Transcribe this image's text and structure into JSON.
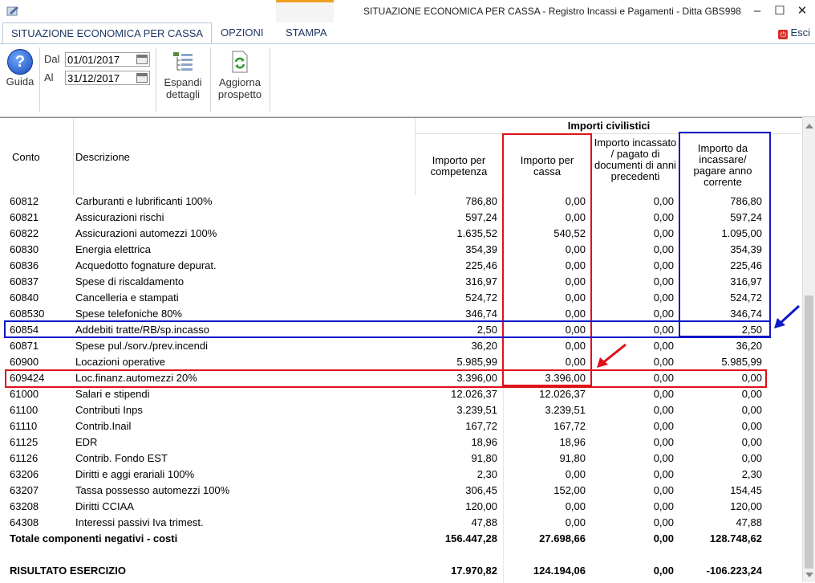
{
  "window": {
    "title": "SITUAZIONE ECONOMICA PER CASSA - Registro Incassi e Pagamenti - Ditta GBS998"
  },
  "tabs": [
    "SITUAZIONE ECONOMICA PER CASSA",
    "OPZIONI",
    "STAMPA"
  ],
  "exit_label": "Esci",
  "ribbon": {
    "guida": "Guida",
    "dal_label": "Dal",
    "dal_value": "01/01/2017",
    "al_label": "Al",
    "al_value": "31/12/2017",
    "espandi": "Espandi dettagli",
    "aggiorna": "Aggiorna prospetto"
  },
  "table": {
    "group_header": "Importi civilistici",
    "col_conto": "Conto",
    "col_desc": "Descrizione",
    "col_competenza": "Importo per competenza",
    "col_cassa": "Importo per cassa",
    "col_precedenti": "Importo incassato / pagato di documenti di anni precedenti",
    "col_corrente": "Importo da incassare/ pagare anno corrente",
    "rows": [
      {
        "conto": "60812",
        "desc": "Carburanti e lubrificanti 100%",
        "competenza": "786,80",
        "cassa": "0,00",
        "precedenti": "0,00",
        "corrente": "786,80"
      },
      {
        "conto": "60821",
        "desc": "Assicurazioni rischi",
        "competenza": "597,24",
        "cassa": "0,00",
        "precedenti": "0,00",
        "corrente": "597,24"
      },
      {
        "conto": "60822",
        "desc": "Assicurazioni automezzi 100%",
        "competenza": "1.635,52",
        "cassa": "540,52",
        "precedenti": "0,00",
        "corrente": "1.095,00"
      },
      {
        "conto": "60830",
        "desc": "Energia elettrica",
        "competenza": "354,39",
        "cassa": "0,00",
        "precedenti": "0,00",
        "corrente": "354,39"
      },
      {
        "conto": "60836",
        "desc": "Acquedotto fognature depurat.",
        "competenza": "225,46",
        "cassa": "0,00",
        "precedenti": "0,00",
        "corrente": "225,46"
      },
      {
        "conto": "60837",
        "desc": "Spese di riscaldamento",
        "competenza": "316,97",
        "cassa": "0,00",
        "precedenti": "0,00",
        "corrente": "316,97"
      },
      {
        "conto": "60840",
        "desc": "Cancelleria e stampati",
        "competenza": "524,72",
        "cassa": "0,00",
        "precedenti": "0,00",
        "corrente": "524,72"
      },
      {
        "conto": "608530",
        "desc": "Spese telefoniche 80%",
        "competenza": "346,74",
        "cassa": "0,00",
        "precedenti": "0,00",
        "corrente": "346,74"
      },
      {
        "conto": "60854",
        "desc": "Addebiti tratte/RB/sp.incasso",
        "competenza": "2,50",
        "cassa": "0,00",
        "precedenti": "0,00",
        "corrente": "2,50"
      },
      {
        "conto": "60871",
        "desc": "Spese pul./sorv./prev.incendi",
        "competenza": "36,20",
        "cassa": "0,00",
        "precedenti": "0,00",
        "corrente": "36,20"
      },
      {
        "conto": "60900",
        "desc": "Locazioni operative",
        "competenza": "5.985,99",
        "cassa": "0,00",
        "precedenti": "0,00",
        "corrente": "5.985,99"
      },
      {
        "conto": "609424",
        "desc": "Loc.finanz.automezzi 20%",
        "competenza": "3.396,00",
        "cassa": "3.396,00",
        "precedenti": "0,00",
        "corrente": "0,00"
      },
      {
        "conto": "61000",
        "desc": "Salari e stipendi",
        "competenza": "12.026,37",
        "cassa": "12.026,37",
        "precedenti": "0,00",
        "corrente": "0,00"
      },
      {
        "conto": "61100",
        "desc": "Contributi Inps",
        "competenza": "3.239,51",
        "cassa": "3.239,51",
        "precedenti": "0,00",
        "corrente": "0,00"
      },
      {
        "conto": "61110",
        "desc": "Contrib.Inail",
        "competenza": "167,72",
        "cassa": "167,72",
        "precedenti": "0,00",
        "corrente": "0,00"
      },
      {
        "conto": "61125",
        "desc": "EDR",
        "competenza": "18,96",
        "cassa": "18,96",
        "precedenti": "0,00",
        "corrente": "0,00"
      },
      {
        "conto": "61126",
        "desc": "Contrib. Fondo EST",
        "competenza": "91,80",
        "cassa": "91,80",
        "precedenti": "0,00",
        "corrente": "0,00"
      },
      {
        "conto": "63206",
        "desc": "Diritti e aggi erariali 100%",
        "competenza": "2,30",
        "cassa": "0,00",
        "precedenti": "0,00",
        "corrente": "2,30"
      },
      {
        "conto": "63207",
        "desc": "Tassa possesso automezzi 100%",
        "competenza": "306,45",
        "cassa": "152,00",
        "precedenti": "0,00",
        "corrente": "154,45"
      },
      {
        "conto": "63208",
        "desc": "Diritti CCIAA",
        "competenza": "120,00",
        "cassa": "0,00",
        "precedenti": "0,00",
        "corrente": "120,00"
      },
      {
        "conto": "64308",
        "desc": "Interessi passivi Iva trimest.",
        "competenza": "47,88",
        "cassa": "0,00",
        "precedenti": "0,00",
        "corrente": "47,88"
      }
    ],
    "total": {
      "label": "Totale componenti negativi - costi",
      "competenza": "156.447,28",
      "cassa": "27.698,66",
      "precedenti": "0,00",
      "corrente": "128.748,62"
    },
    "result": {
      "label": "RISULTATO ESERCIZIO",
      "competenza": "17.970,82",
      "cassa": "124.194,06",
      "precedenti": "0,00",
      "corrente": "-106.223,24"
    }
  },
  "colors": {
    "highlight_red": "#e0101a",
    "highlight_blue": "#1018c8",
    "accent": "#f0a020"
  }
}
